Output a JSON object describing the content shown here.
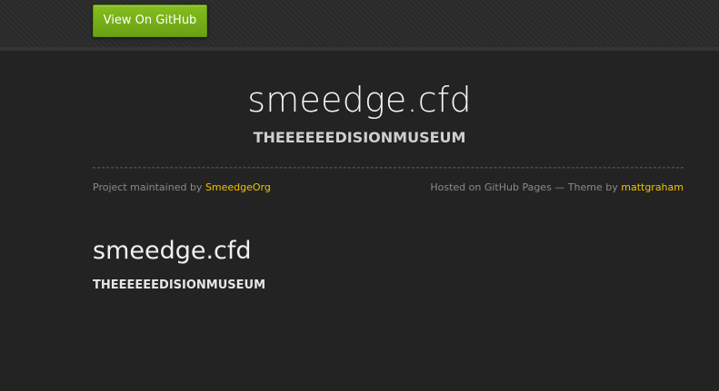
{
  "header": {
    "github_button_label": "View On GitHub"
  },
  "hero": {
    "title": "smeedge.cfd",
    "tagline": "THEEEEEEDISIONMUSEUM"
  },
  "meta": {
    "maintained_prefix": "Project maintained by",
    "maintainer": "SmeedgeOrg",
    "hosted_prefix": "Hosted on GitHub Pages — Theme by",
    "theme_author": "mattgraham"
  },
  "main": {
    "heading": "smeedge.cfd",
    "subheading": "THEEEEEEDISIONMUSEUM"
  },
  "colors": {
    "background": "#232323",
    "button_green": "#75ad18",
    "link_yellow": "#f2c200"
  }
}
